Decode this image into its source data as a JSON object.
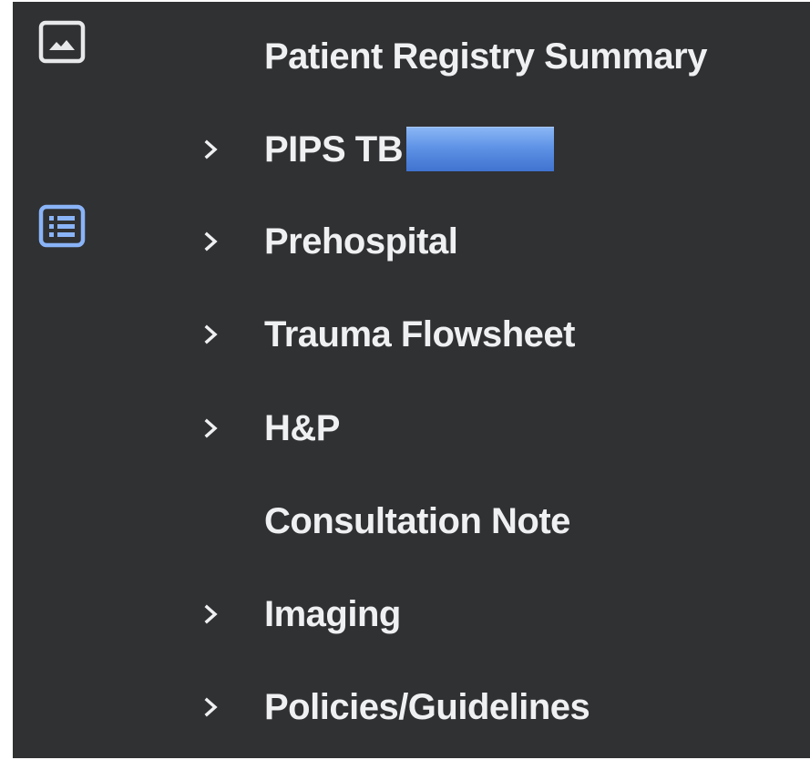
{
  "rail": {
    "icons": [
      {
        "name": "image-icon",
        "color": "#e6e8ea"
      },
      {
        "name": "list-icon",
        "color": "#8ab4f8"
      }
    ]
  },
  "nav": {
    "items": [
      {
        "label": "Patient Registry Summary",
        "expandable": false
      },
      {
        "label": "PIPS TB",
        "expandable": true,
        "redacted_suffix": true
      },
      {
        "label": "Prehospital",
        "expandable": true
      },
      {
        "label": "Trauma Flowsheet",
        "expandable": true
      },
      {
        "label": "H&P",
        "expandable": true
      },
      {
        "label": "Consultation Note",
        "expandable": false
      },
      {
        "label": "Imaging",
        "expandable": true
      },
      {
        "label": "Policies/Guidelines",
        "expandable": true
      }
    ],
    "chevron_icon": "chevron-right-icon"
  },
  "colors": {
    "background": "#303133",
    "text": "#eef0f2",
    "accent": "#8ab4f8",
    "redaction": "#5f93e6"
  }
}
